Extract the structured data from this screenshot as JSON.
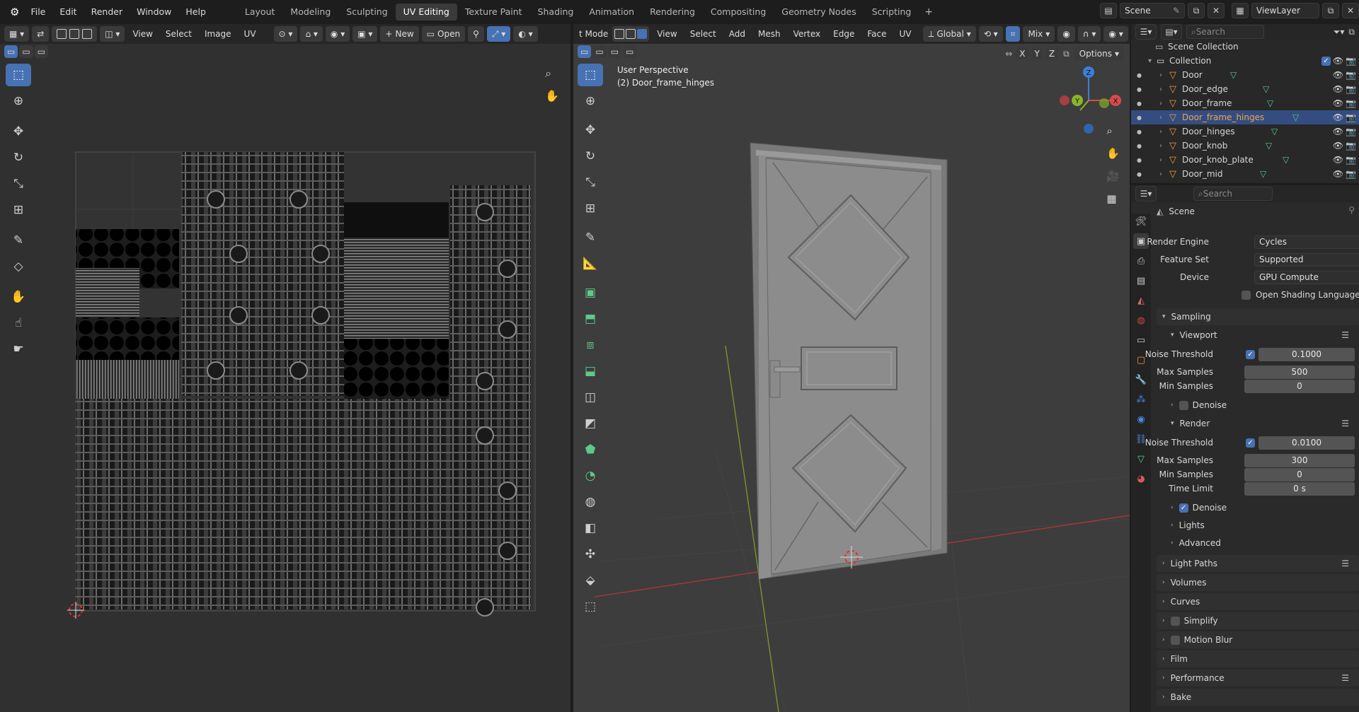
{
  "app": {
    "menus": [
      "File",
      "Edit",
      "Render",
      "Window",
      "Help"
    ],
    "workspaces": [
      "Layout",
      "Modeling",
      "Sculpting",
      "UV Editing",
      "Texture Paint",
      "Shading",
      "Animation",
      "Rendering",
      "Compositing",
      "Geometry Nodes",
      "Scripting"
    ],
    "active_workspace": "UV Editing",
    "add_workspace": "+",
    "scene": "Scene",
    "view_layer": "ViewLayer"
  },
  "uv_editor": {
    "menus": [
      "View",
      "Select",
      "Image",
      "UV"
    ],
    "new_label": "New",
    "open_label": "Open"
  },
  "viewport": {
    "mode_label": "t Mode",
    "menus": [
      "View",
      "Select",
      "Add",
      "Mesh",
      "Vertex",
      "Edge",
      "Face",
      "UV"
    ],
    "orientation": "Global",
    "snap_mode": "Mix",
    "options_label": "Options",
    "axis_x": "X",
    "axis_y": "Y",
    "axis_z": "Z",
    "perspective_label": "User Perspective",
    "object_label": "(2) Door_frame_hinges",
    "gizmo": {
      "x": "X",
      "y": "Y",
      "z": "Z"
    }
  },
  "outliner": {
    "search_placeholder": "Search",
    "scene_collection": "Scene Collection",
    "collection": "Collection",
    "objects": [
      "Door",
      "Door_edge",
      "Door_frame",
      "Door_frame_hinges",
      "Door_hinges",
      "Door_knob",
      "Door_knob_plate",
      "Door_mid"
    ],
    "selected": "Door_frame_hinges"
  },
  "properties": {
    "search_placeholder": "Search",
    "context": "Scene",
    "render_engine_label": "Render Engine",
    "render_engine": "Cycles",
    "feature_set_label": "Feature Set",
    "feature_set": "Supported",
    "device_label": "Device",
    "device": "GPU Compute",
    "osl_label": "Open Shading Language",
    "sampling": "Sampling",
    "viewport": {
      "title": "Viewport",
      "noise_threshold_label": "Noise Threshold",
      "noise_threshold": "0.1000",
      "max_samples_label": "Max Samples",
      "max_samples": "500",
      "min_samples_label": "Min Samples",
      "min_samples": "0",
      "denoise_label": "Denoise"
    },
    "render": {
      "title": "Render",
      "noise_threshold_label": "Noise Threshold",
      "noise_threshold": "0.0100",
      "max_samples_label": "Max Samples",
      "max_samples": "300",
      "min_samples_label": "Min Samples",
      "min_samples": "0",
      "time_limit_label": "Time Limit",
      "time_limit": "0 s",
      "denoise_label": "Denoise"
    },
    "lights": "Lights",
    "advanced": "Advanced",
    "panels": [
      "Light Paths",
      "Volumes",
      "Curves",
      "Simplify",
      "Motion Blur",
      "Film",
      "Performance",
      "Bake"
    ]
  },
  "colors": {
    "accent": "#4772b3",
    "selected_row": "#334d80",
    "object_icon": "#f09a3c",
    "mesh_icon": "#5fc98a",
    "x_axis": "#d94a4a",
    "y_axis": "#8ab52a",
    "z_axis": "#3d7fd9"
  }
}
